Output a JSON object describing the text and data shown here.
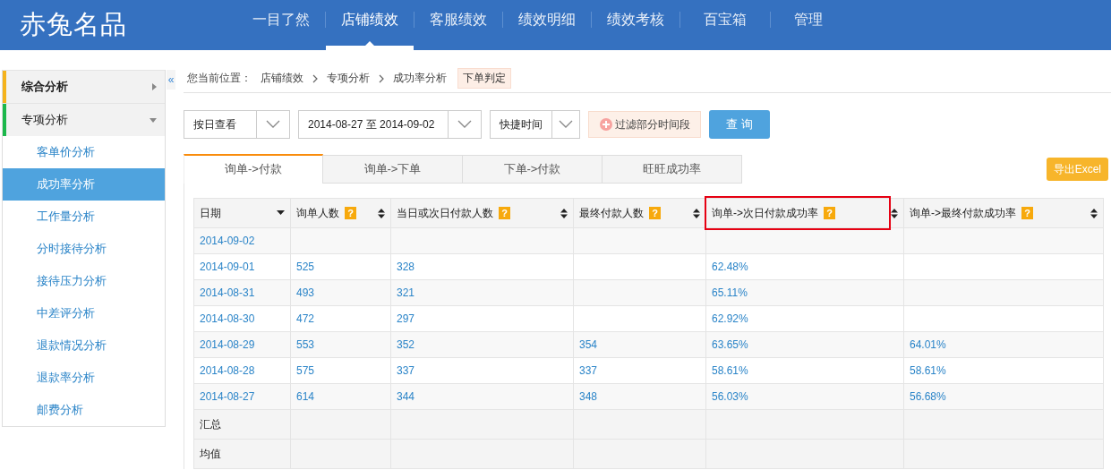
{
  "brand": "赤兔名品",
  "nav": [
    {
      "label": "一目了然",
      "selected": false
    },
    {
      "label": "店铺绩效",
      "selected": true
    },
    {
      "label": "客服绩效",
      "selected": false
    },
    {
      "label": "绩效明细",
      "selected": false
    },
    {
      "label": "绩效考核",
      "selected": false
    },
    {
      "label": "百宝箱",
      "selected": false
    },
    {
      "label": "管理",
      "selected": false
    }
  ],
  "sidebar": {
    "collapse": "«",
    "groups": [
      {
        "label": "综合分析",
        "color": "#f5b31c",
        "expanded": false
      },
      {
        "label": "专项分析",
        "color": "#1cb84c",
        "expanded": true,
        "children": [
          {
            "label": "客单价分析",
            "selected": false
          },
          {
            "label": "成功率分析",
            "selected": true
          },
          {
            "label": "工作量分析",
            "selected": false
          },
          {
            "label": "分时接待分析",
            "selected": false
          },
          {
            "label": "接待压力分析",
            "selected": false
          },
          {
            "label": "中差评分析",
            "selected": false
          },
          {
            "label": "退款情况分析",
            "selected": false
          },
          {
            "label": "退款率分析",
            "selected": false
          },
          {
            "label": "邮费分析",
            "selected": false
          }
        ]
      }
    ]
  },
  "breadcrumb": {
    "prefix": "您当前位置：",
    "items": [
      "店铺绩效",
      "专项分析",
      "成功率分析"
    ],
    "tag": "下单判定"
  },
  "filters": {
    "view": "按日查看",
    "date_range": "2014-08-27 至 2014-09-02",
    "quick": "快捷时间",
    "filter_button": "过滤部分时间段",
    "query_button": "查 询"
  },
  "tabs": [
    {
      "label": "询单->付款",
      "selected": true
    },
    {
      "label": "询单->下单",
      "selected": false
    },
    {
      "label": "下单->付款",
      "selected": false
    },
    {
      "label": "旺旺成功率",
      "selected": false
    }
  ],
  "export_button": "导出Excel",
  "table": {
    "columns": [
      {
        "label": "日期",
        "sorted": true,
        "highlighted": false
      },
      {
        "label": "询单人数",
        "help": "?",
        "sorted": false,
        "highlighted": false
      },
      {
        "label": "当日或次日付款人数",
        "help": "?",
        "sorted": false,
        "highlighted": false
      },
      {
        "label": "最终付款人数",
        "help": "?",
        "sorted": false,
        "highlighted": false
      },
      {
        "label": "询单->次日付款成功率",
        "help": "?",
        "sorted": false,
        "highlighted": true
      },
      {
        "label": "询单->最终付款成功率",
        "help": "?",
        "sorted": false,
        "highlighted": false
      }
    ],
    "rows": [
      {
        "kind": "data",
        "cells": [
          "2014-09-02",
          null,
          null,
          null,
          null,
          null
        ]
      },
      {
        "kind": "data",
        "cells": [
          "2014-09-01",
          "525",
          "328",
          null,
          "62.48%",
          null
        ]
      },
      {
        "kind": "data",
        "cells": [
          "2014-08-31",
          "493",
          "321",
          null,
          "65.11%",
          null
        ]
      },
      {
        "kind": "data",
        "cells": [
          "2014-08-30",
          "472",
          "297",
          null,
          "62.92%",
          null
        ]
      },
      {
        "kind": "data",
        "cells": [
          "2014-08-29",
          "553",
          "352",
          "354",
          "63.65%",
          "64.01%"
        ]
      },
      {
        "kind": "data",
        "cells": [
          "2014-08-28",
          "575",
          "337",
          "337",
          "58.61%",
          "58.61%"
        ]
      },
      {
        "kind": "data",
        "cells": [
          "2014-08-27",
          "614",
          "344",
          "348",
          "56.03%",
          "56.68%"
        ]
      },
      {
        "kind": "summary",
        "cells": [
          "汇总",
          null,
          null,
          null,
          null,
          null
        ]
      },
      {
        "kind": "summary",
        "cells": [
          "均值",
          null,
          null,
          null,
          null,
          null
        ]
      }
    ]
  }
}
